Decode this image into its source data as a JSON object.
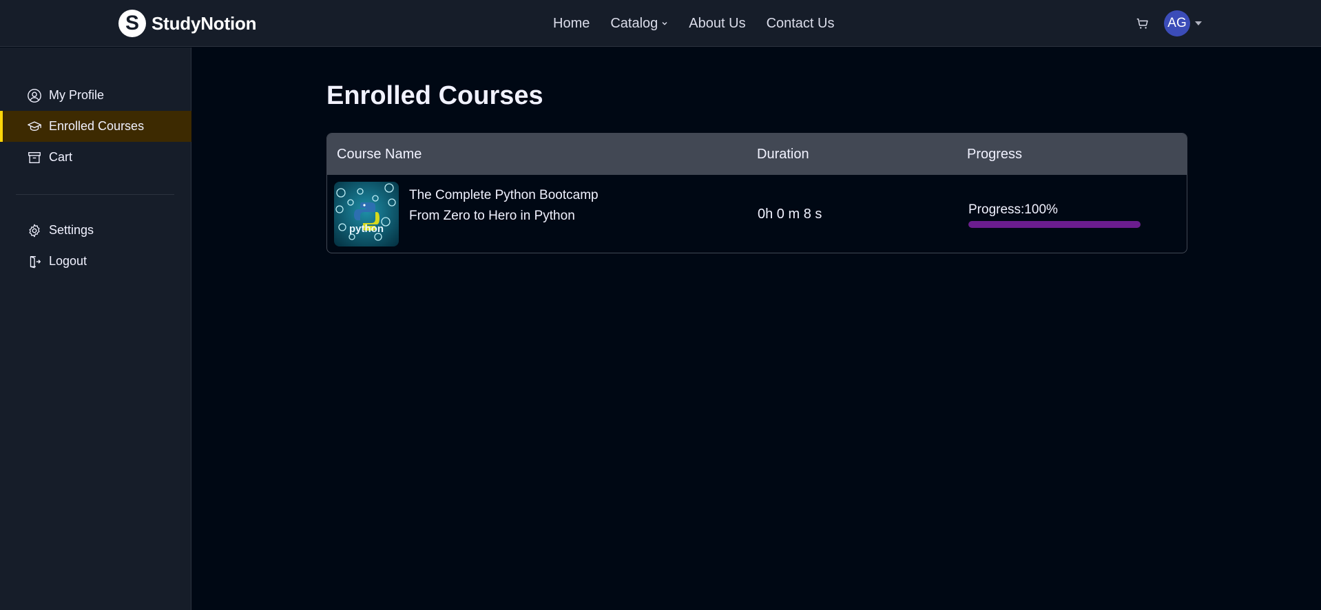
{
  "brand": {
    "name": "StudyNotion",
    "logo_letter": "S"
  },
  "nav": {
    "links": [
      {
        "label": "Home"
      },
      {
        "label": "Catalog"
      },
      {
        "label": "About Us"
      },
      {
        "label": "Contact Us"
      }
    ]
  },
  "user": {
    "initials": "AG"
  },
  "sidebar": {
    "items": [
      {
        "label": "My Profile",
        "icon": "profile-icon"
      },
      {
        "label": "Enrolled Courses",
        "icon": "graduation-cap-icon",
        "active": true
      },
      {
        "label": "Cart",
        "icon": "archive-icon"
      }
    ],
    "bottom_items": [
      {
        "label": "Settings",
        "icon": "gear-icon"
      },
      {
        "label": "Logout",
        "icon": "logout-icon"
      }
    ]
  },
  "main": {
    "title": "Enrolled Courses",
    "table": {
      "headers": {
        "name": "Course Name",
        "duration": "Duration",
        "progress": "Progress"
      },
      "rows": [
        {
          "name": "The Complete Python Bootcamp From Zero to Hero in Python",
          "duration": "0h 0 m 8 s",
          "progress_label": "Progress:100%",
          "progress_percent": 100
        }
      ]
    }
  },
  "colors": {
    "accent_yellow": "#FFD60A",
    "active_bg": "#3D2A01",
    "progress_fill": "#6B1D8F",
    "avatar_bg": "#3B4CB8"
  }
}
